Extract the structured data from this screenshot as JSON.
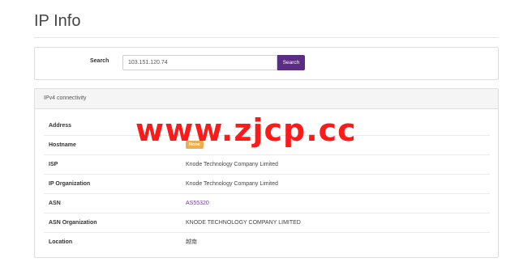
{
  "page": {
    "title": "IP Info"
  },
  "search": {
    "label": "Search",
    "value": "103.151.120.74",
    "button_label": "Search"
  },
  "connectivity": {
    "header": "IPv4 connectivity",
    "rows": [
      {
        "key": "Address",
        "value": ""
      },
      {
        "key": "Hostname",
        "badge": "None"
      },
      {
        "key": "ISP",
        "value": "Knode Technology Company Limited"
      },
      {
        "key": "IP Organization",
        "value": "Knode Technology Company Limited"
      },
      {
        "key": "ASN",
        "link": "AS55320"
      },
      {
        "key": "ASN Organization",
        "value": "KNODE TECHNOLOGY COMPANY LIMITED"
      },
      {
        "key": "Location",
        "value": "越南"
      }
    ]
  },
  "watermark": {
    "text": "www.zjcp.cc"
  },
  "colors": {
    "accent": "#5b2c83",
    "link": "#6a3a99",
    "badge": "#f0ad4e",
    "watermark": "#ff1a1a"
  }
}
